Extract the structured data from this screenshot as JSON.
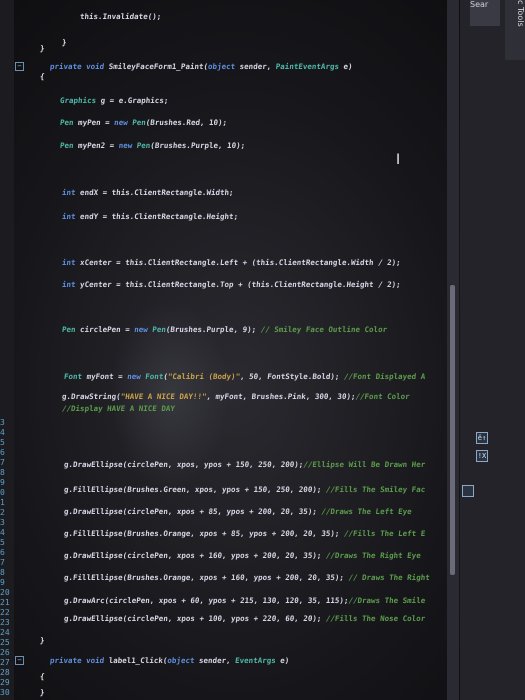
{
  "editor": {
    "lines": [
      {
        "indent": 2,
        "parts": [
          {
            "c": "txt",
            "t": "this.Invalidate();"
          }
        ]
      },
      {
        "indent": 1,
        "parts": [
          {
            "c": "brace",
            "t": "}"
          }
        ]
      },
      {
        "indent": 0,
        "parts": [
          {
            "c": "brace",
            "t": "}"
          }
        ]
      },
      {
        "indent": 0,
        "parts": [
          {
            "c": "kw",
            "t": "private void "
          },
          {
            "c": "txt",
            "t": "SmileyFaceForm1_Paint("
          },
          {
            "c": "kw",
            "t": "object "
          },
          {
            "c": "txt",
            "t": "sender, "
          },
          {
            "c": "type",
            "t": "PaintEventArgs "
          },
          {
            "c": "txt",
            "t": "e)"
          }
        ]
      },
      {
        "indent": 0,
        "parts": [
          {
            "c": "brace",
            "t": "{"
          }
        ]
      },
      {
        "indent": 1,
        "parts": [
          {
            "c": "type",
            "t": "Graphics "
          },
          {
            "c": "txt",
            "t": "g = e.Graphics;"
          }
        ]
      },
      {
        "indent": 1,
        "parts": [
          {
            "c": "type",
            "t": "Pen "
          },
          {
            "c": "txt",
            "t": "myPen = "
          },
          {
            "c": "kw",
            "t": "new "
          },
          {
            "c": "type",
            "t": "Pen"
          },
          {
            "c": "txt",
            "t": "(Brushes.Red, 10);"
          }
        ]
      },
      {
        "indent": 1,
        "parts": [
          {
            "c": "type",
            "t": "Pen "
          },
          {
            "c": "txt",
            "t": "myPen2 = "
          },
          {
            "c": "kw",
            "t": "new "
          },
          {
            "c": "type",
            "t": "Pen"
          },
          {
            "c": "txt",
            "t": "(Brushes.Purple, 10);"
          }
        ]
      },
      {
        "indent": 1,
        "parts": [
          {
            "c": "kw",
            "t": "int "
          },
          {
            "c": "txt",
            "t": "endX = this.ClientRectangle.Width;"
          }
        ]
      },
      {
        "indent": 1,
        "parts": [
          {
            "c": "kw",
            "t": "int "
          },
          {
            "c": "txt",
            "t": "endY = this.ClientRectangle.Height;"
          }
        ]
      },
      {
        "indent": 1,
        "parts": [
          {
            "c": "kw",
            "t": "int "
          },
          {
            "c": "txt",
            "t": "xCenter = this.ClientRectangle.Left + (this.ClientRectangle.Width / 2);"
          }
        ]
      },
      {
        "indent": 1,
        "parts": [
          {
            "c": "kw",
            "t": "int "
          },
          {
            "c": "txt",
            "t": "yCenter = this.ClientRectangle.Top + (this.ClientRectangle.Height / 2);"
          }
        ]
      },
      {
        "indent": 1,
        "parts": [
          {
            "c": "type",
            "t": "Pen "
          },
          {
            "c": "txt",
            "t": "circlePen = "
          },
          {
            "c": "kw",
            "t": "new "
          },
          {
            "c": "type",
            "t": "Pen"
          },
          {
            "c": "txt",
            "t": "(Brushes.Purple, 9); "
          },
          {
            "c": "cmt",
            "t": "// Smiley Face Outline Color"
          }
        ]
      },
      {
        "indent": 1,
        "parts": [
          {
            "c": "type",
            "t": "Font "
          },
          {
            "c": "txt",
            "t": "myFont = "
          },
          {
            "c": "kw",
            "t": "new "
          },
          {
            "c": "type",
            "t": "Font"
          },
          {
            "c": "txt",
            "t": "("
          },
          {
            "c": "str",
            "t": "\"Calibri (Body)\""
          },
          {
            "c": "txt",
            "t": ", 50, FontStyle.Bold); "
          },
          {
            "c": "cmt",
            "t": "//Font Displayed A"
          }
        ]
      },
      {
        "indent": 1,
        "parts": [
          {
            "c": "txt",
            "t": "g.DrawString("
          },
          {
            "c": "str",
            "t": "\"HAVE A NICE DAY!!\""
          },
          {
            "c": "txt",
            "t": ", myFont, Brushes.Pink, 300, 30);"
          },
          {
            "c": "cmt",
            "t": "//Font Color"
          }
        ]
      },
      {
        "indent": 1,
        "parts": [
          {
            "c": "cmt",
            "t": "//Display HAVE A NICE DAY"
          }
        ]
      },
      {
        "indent": 1,
        "parts": [
          {
            "c": "txt",
            "t": "g.DrawEllipse(circlePen, xpos, ypos + 150, 250, 200);"
          },
          {
            "c": "cmt",
            "t": "//Ellipse Will Be Drawn Her"
          }
        ]
      },
      {
        "indent": 1,
        "parts": [
          {
            "c": "txt",
            "t": "g.FillEllipse(Brushes.Green, xpos, ypos + 150, 250, 200); "
          },
          {
            "c": "cmt",
            "t": "//Fills The Smiley Fac"
          }
        ]
      },
      {
        "indent": 1,
        "parts": [
          {
            "c": "txt",
            "t": "g.DrawEllipse(circlePen, xpos + 85, ypos + 200, 20, 35); "
          },
          {
            "c": "cmt",
            "t": "//Draws The Left Eye"
          }
        ]
      },
      {
        "indent": 1,
        "parts": [
          {
            "c": "txt",
            "t": "g.FillEllipse(Brushes.Orange, xpos + 85, ypos + 200, 20, 35); "
          },
          {
            "c": "cmt",
            "t": "//Fills The Left E"
          }
        ]
      },
      {
        "indent": 1,
        "parts": [
          {
            "c": "txt",
            "t": "g.DrawEllipse(circlePen, xpos + 160, ypos + 200, 20, 35); "
          },
          {
            "c": "cmt",
            "t": "//Draws The Right Eye"
          }
        ]
      },
      {
        "indent": 1,
        "parts": [
          {
            "c": "txt",
            "t": "g.FillEllipse(Brushes.Orange, xpos + 160, ypos + 200, 20, 35); "
          },
          {
            "c": "cmt",
            "t": "// Draws The Right"
          }
        ]
      },
      {
        "indent": 1,
        "parts": [
          {
            "c": "txt",
            "t": "g.DrawArc(circlePen, xpos + 60, ypos + 215, 130, 120, 35, 115);"
          },
          {
            "c": "cmt",
            "t": "//Draws The Smile"
          }
        ]
      },
      {
        "indent": 1,
        "parts": [
          {
            "c": "txt",
            "t": "g.DrawEllipse(circlePen, xpos + 100, ypos + 220, 60, 20); "
          },
          {
            "c": "cmt",
            "t": "//Fills The Nose Color"
          }
        ]
      },
      {
        "indent": 0,
        "parts": [
          {
            "c": "brace",
            "t": "}"
          }
        ]
      },
      {
        "indent": 0,
        "parts": [
          {
            "c": "kw",
            "t": "private void "
          },
          {
            "c": "txt",
            "t": "label1_Click("
          },
          {
            "c": "kw",
            "t": "object "
          },
          {
            "c": "txt",
            "t": "sender, "
          },
          {
            "c": "type",
            "t": "EventArgs "
          },
          {
            "c": "txt",
            "t": "e)"
          }
        ]
      },
      {
        "indent": 0,
        "parts": [
          {
            "c": "brace",
            "t": "{"
          }
        ]
      },
      {
        "indent": 0,
        "parts": [
          {
            "c": "brace",
            "t": "}"
          }
        ]
      }
    ],
    "line_numbers": [
      "3",
      "4",
      "5",
      "6",
      "7",
      "8",
      "9",
      "0",
      "1",
      "2",
      "3",
      "4",
      "5",
      "6",
      "7",
      "8",
      "9",
      "20",
      "21",
      "22",
      "23",
      "24",
      "25",
      "26",
      "27",
      "28",
      "29",
      "30"
    ]
  },
  "side_panel": {
    "search_label": "Sear",
    "tools_tab_label": "c Tools",
    "mini_icons": [
      "ĕ↑",
      "!X"
    ]
  }
}
